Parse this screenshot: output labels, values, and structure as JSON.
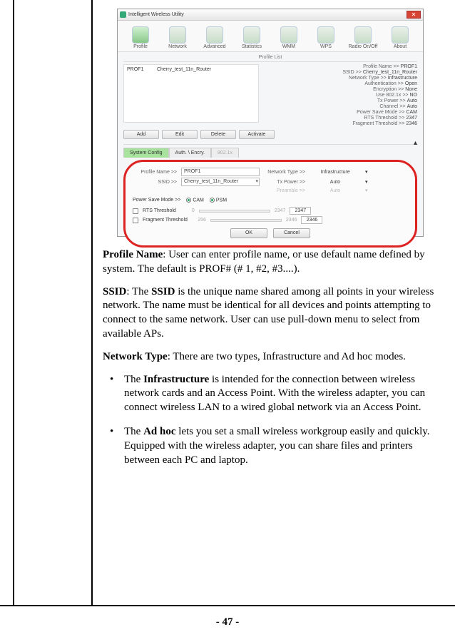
{
  "page_number_display": "- 47 -",
  "app": {
    "title": "Intelligent Wireless Utility",
    "close": "✕",
    "tabs": [
      "Profile",
      "Network",
      "Advanced",
      "Statistics",
      "WMM",
      "WPS",
      "Radio On/Off",
      "About"
    ],
    "profile_list_heading": "Profile List",
    "profile_col1": "PROF1",
    "profile_col2": "Cherry_test_11n_Router",
    "info": {
      "profile_name": {
        "label": "Profile Name >>",
        "value": "PROF1"
      },
      "ssid": {
        "label": "SSID >>",
        "value": "Cherry_test_11n_Router"
      },
      "network_type": {
        "label": "Network Type >>",
        "value": "Infrastructure"
      },
      "auth": {
        "label": "Authentication >>",
        "value": "Open"
      },
      "enc": {
        "label": "Encryption >>",
        "value": "None"
      },
      "use802": {
        "label": "Use 802.1x >>",
        "value": "NO"
      },
      "txpower": {
        "label": "Tx Power >>",
        "value": "Auto"
      },
      "channel": {
        "label": "Channel >>",
        "value": "Auto"
      },
      "psm": {
        "label": "Power Save Mode >>",
        "value": "CAM"
      },
      "rts": {
        "label": "RTS Threshold >>",
        "value": "2347"
      },
      "frag": {
        "label": "Fragment Threshold >>",
        "value": "2346"
      }
    },
    "buttons": {
      "add": "Add",
      "edit": "Edit",
      "delete": "Delete",
      "activate": "Activate"
    },
    "subtabs": {
      "sysconf": "System Config",
      "auth": "Auth. \\ Encry.",
      "dot1x": "802.1x"
    },
    "form": {
      "profile_name_label": "Profile Name >>",
      "profile_name_value": "PROF1",
      "ssid_label": "SSID >>",
      "ssid_value": "Cherry_test_11n_Router",
      "network_type_label": "Network Type >>",
      "network_type_value": "Infrastructure",
      "txpower_label": "Tx Power >>",
      "txpower_value": "Auto",
      "preamble_label": "Preamble >>",
      "preamble_value": "Auto",
      "psm_label": "Power Save Mode >>",
      "cam": "CAM",
      "psm": "PSM",
      "rts_label": "RTS Threshold",
      "rts_def": "0",
      "rts_max": "2347",
      "rts_val": "2347",
      "frag_label": "Fragment Threshold",
      "frag_def": "256",
      "frag_max": "2346",
      "frag_val": "2346",
      "ok": "OK",
      "cancel": "Cancel"
    }
  },
  "doc": {
    "p1_a": "Profile Name",
    "p1_b": ": User can enter profile name, or use default name defined by system. The default is PROF# (# 1, #2, #3....).",
    "p2_a": "SSID",
    "p2_b": ": The ",
    "p2_c": "SSID",
    "p2_d": " is the unique name shared among all points in your wireless network. The name must be identical for all devices and points attempting to connect to the same network. User can use pull-down menu to select from available APs.",
    "p3_a": "Network Type",
    "p3_b": ": There are two types, Infrastructure and Ad hoc modes.",
    "li1_a": "The ",
    "li1_b": "Infrastructure",
    "li1_c": " is intended for the connection between wireless network cards and an Access Point. With the wireless adapter, you can connect wireless LAN to a wired global network via an Access Point.",
    "li2_a": "The ",
    "li2_b": "Ad hoc",
    "li2_c": " lets you set a small wireless workgroup easily and quickly. Equipped with the wireless adapter, you can share files and printers between each PC and laptop."
  }
}
